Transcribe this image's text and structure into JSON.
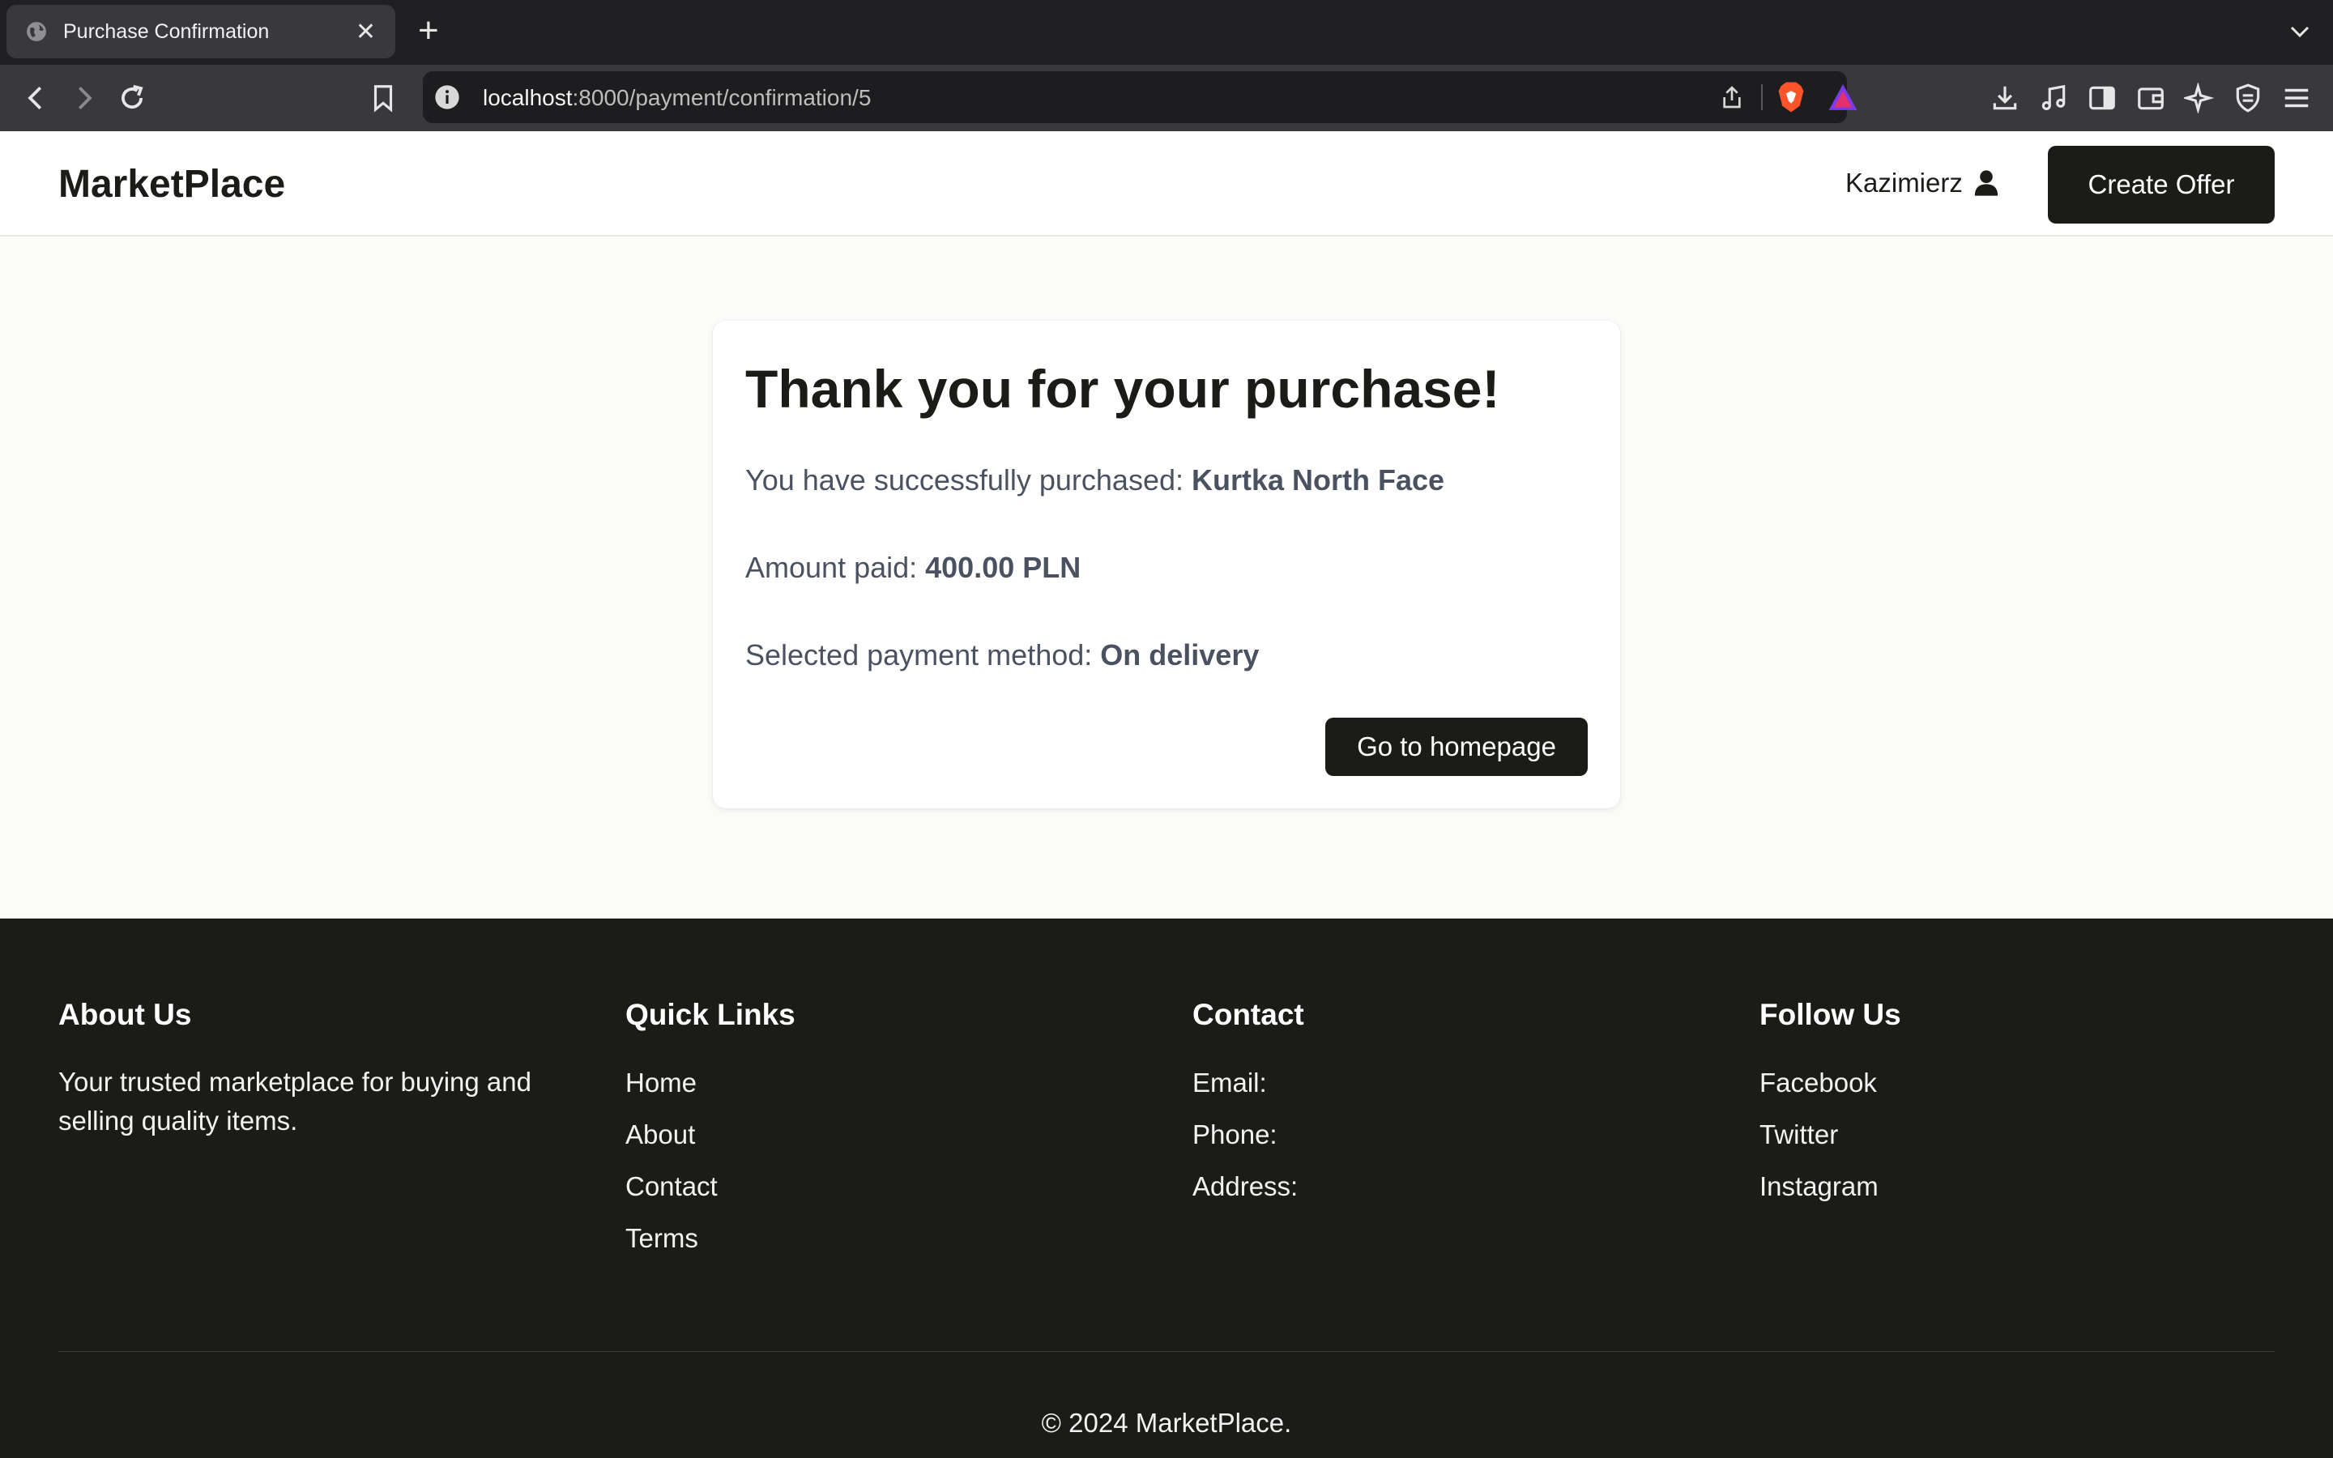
{
  "browser": {
    "tab_title": "Purchase Confirmation",
    "url_host": "localhost",
    "url_rest": ":8000/payment/confirmation/5"
  },
  "header": {
    "logo": "MarketPlace",
    "user_name": "Kazimierz",
    "create_offer_label": "Create Offer"
  },
  "confirmation": {
    "title": "Thank you for your purchase!",
    "purchased_prefix": "You have successfully purchased: ",
    "item_name": "Kurtka North Face",
    "amount_prefix": "Amount paid: ",
    "amount": "400.00 PLN",
    "payment_prefix": "Selected payment method: ",
    "payment_method": "On delivery",
    "go_home_label": "Go to homepage"
  },
  "footer": {
    "about": {
      "heading": "About Us",
      "text": "Your trusted marketplace for buying and selling quality items."
    },
    "quick_links": {
      "heading": "Quick Links",
      "items": [
        "Home",
        "About",
        "Contact",
        "Terms"
      ]
    },
    "contact": {
      "heading": "Contact",
      "items": [
        "Email:",
        "Phone:",
        "Address:"
      ]
    },
    "follow": {
      "heading": "Follow Us",
      "items": [
        "Facebook",
        "Twitter",
        "Instagram"
      ]
    },
    "copyright": "© 2024 MarketPlace."
  },
  "colors": {
    "dark": "#1b1b18",
    "page_bg": "#fbfbf9",
    "muted_text": "#4a5261"
  }
}
